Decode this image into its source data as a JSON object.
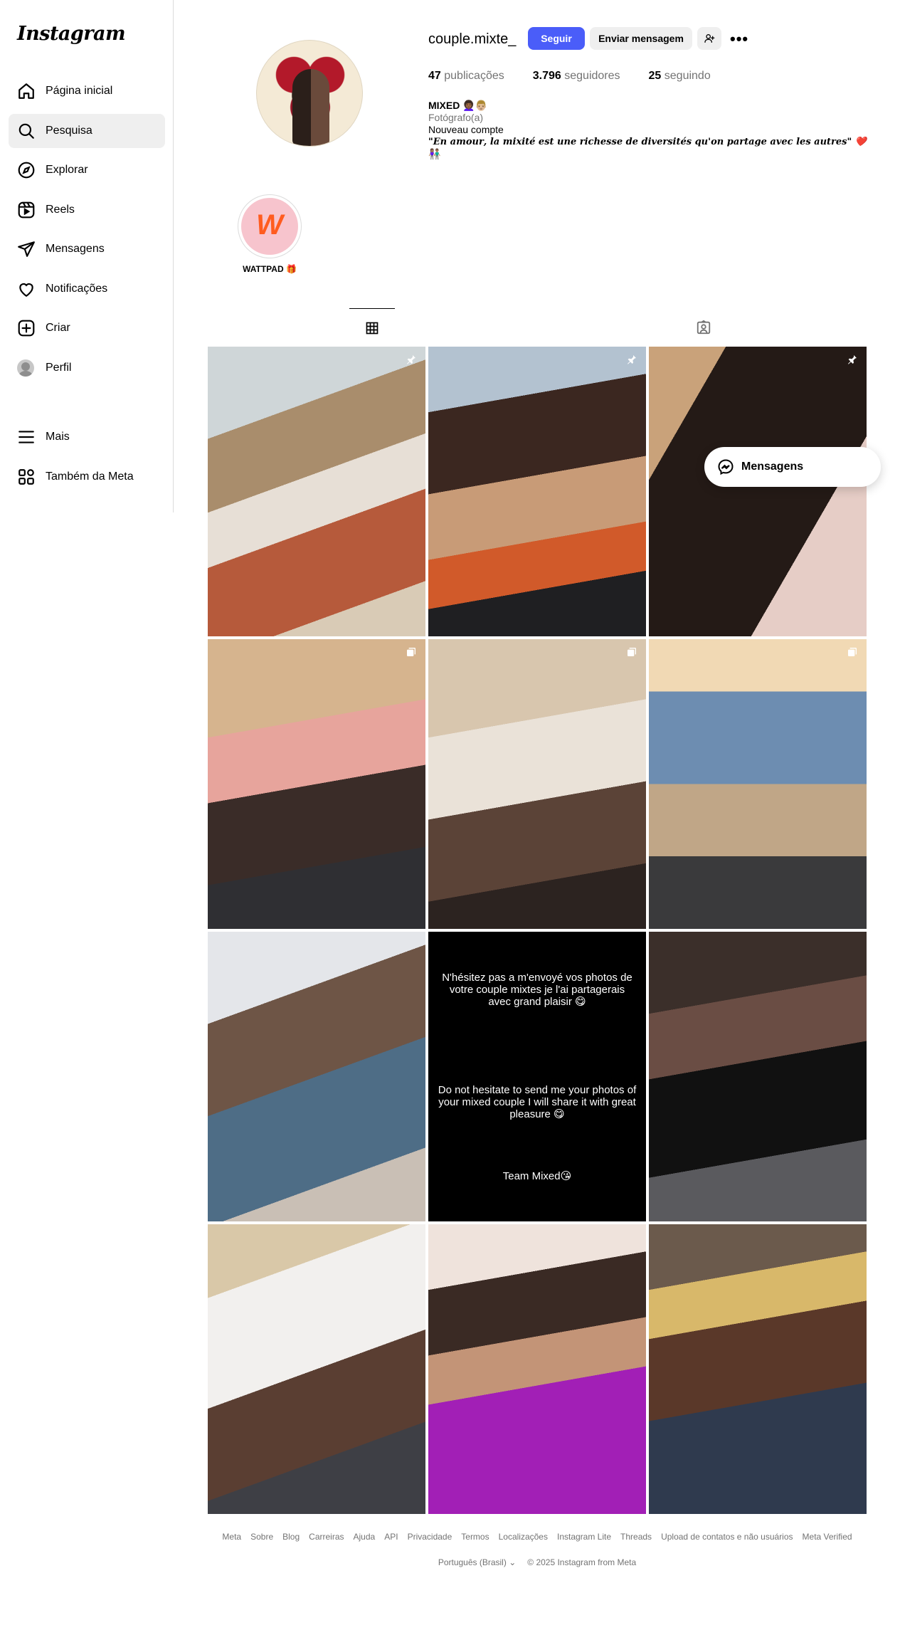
{
  "app": {
    "logo": "Instagram"
  },
  "sidebar": {
    "items": [
      {
        "label": "Página inicial",
        "icon": "home-icon"
      },
      {
        "label": "Pesquisa",
        "icon": "search-icon",
        "active": true
      },
      {
        "label": "Explorar",
        "icon": "compass-icon"
      },
      {
        "label": "Reels",
        "icon": "reels-icon"
      },
      {
        "label": "Mensagens",
        "icon": "paper-plane-icon"
      },
      {
        "label": "Notificações",
        "icon": "heart-icon"
      },
      {
        "label": "Criar",
        "icon": "plus-square-icon"
      },
      {
        "label": "Perfil",
        "icon": "avatar-icon"
      }
    ],
    "more": "Mais",
    "meta": "Também da Meta"
  },
  "profile": {
    "username": "couple.mixte_",
    "follow_label": "Seguir",
    "message_label": "Enviar mensagem",
    "stats": {
      "posts_num": "47",
      "posts_label": "publicações",
      "followers_num": "3.796",
      "followers_label": "seguidores",
      "following_num": "25",
      "following_label": "seguindo"
    },
    "bio": {
      "name": "MIXED 👩🏾‍🦱👨🏼",
      "category": "Fotógrafo(a)",
      "line1": "Nouveau compte",
      "quote": "\"𝑬𝒏 𝒂𝒎𝒐𝒖𝒓, 𝒍𝒂 𝒎𝒊𝒙𝒊𝒕𝒆́ 𝒆𝒔𝒕 𝒖𝒏𝒆 𝒓𝒊𝒄𝒉𝒆𝒔𝒔𝒆 𝒅𝒆 𝒅𝒊𝒗𝒆𝒓𝒔𝒊𝒕𝒆́𝒔 𝒒𝒖'𝒐𝒏 𝒑𝒂𝒓𝒕𝒂𝒈𝒆 𝒂𝒗𝒆𝒄 𝒍𝒆𝒔 𝒂𝒖𝒕𝒓𝒆𝒔\" ❤️",
      "line2": "👫🏽"
    }
  },
  "highlights": [
    {
      "label": "WATTPAD 🎁"
    }
  ],
  "tabs": [
    {
      "icon": "grid-icon",
      "active": true
    },
    {
      "icon": "tagged-icon"
    }
  ],
  "posts": {
    "text_post": {
      "p1": "N'hésitez pas a m'envoyé vos photos de votre couple mixtes je l'ai partagerais avec grand plaisir 😋",
      "p2": "Do not hesitate to send me your photos of your mixed couple I will share it with great pleasure 😋",
      "p3": "Team Mixed😘"
    }
  },
  "floating": {
    "messages_label": "Mensagens"
  },
  "footer": {
    "links": [
      "Meta",
      "Sobre",
      "Blog",
      "Carreiras",
      "Ajuda",
      "API",
      "Privacidade",
      "Termos",
      "Localizações",
      "Instagram Lite",
      "Threads",
      "Upload de contatos e não usuários",
      "Meta Verified"
    ],
    "language": "Português (Brasil)",
    "copyright": "© 2025 Instagram from Meta"
  },
  "colors": {
    "accent": "#4a5df9",
    "text_secondary": "#737373",
    "border": "#dbdbdb"
  }
}
